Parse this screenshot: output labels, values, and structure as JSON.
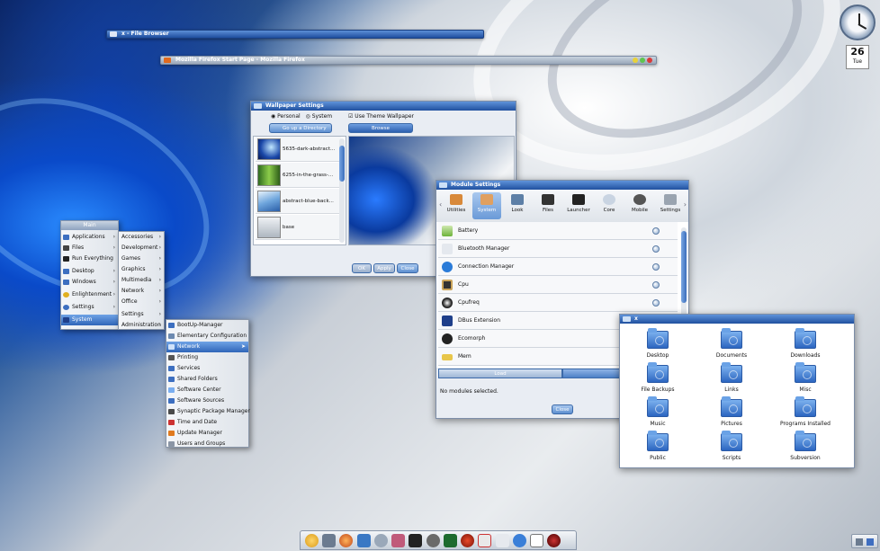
{
  "file_browser": {
    "title": "x - File Browser"
  },
  "firefox": {
    "title": "Mozilla Firefox Start Page - Mozilla Firefox"
  },
  "clock": {
    "day": "26",
    "weekday": "Tue"
  },
  "wallpaper": {
    "title": "Wallpaper Settings",
    "personal": "Personal",
    "system": "System",
    "use_theme": "Use Theme Wallpaper",
    "go_up": "Go up a Directory",
    "browse": "Browse",
    "items": [
      "5635-dark-abstract...",
      "6255-in-the-grass-...",
      "abstract-blue-back...",
      "base"
    ],
    "ok": "OK",
    "apply": "Apply",
    "close": "Close"
  },
  "module": {
    "title": "Module Settings",
    "tabs": [
      "Utilities",
      "System",
      "Look",
      "Files",
      "Launcher",
      "Core",
      "Mobile",
      "Settings"
    ],
    "rows": [
      "Battery",
      "Bluetooth Manager",
      "Connection Manager",
      "Cpu",
      "Cpufreq",
      "DBus Extension",
      "Ecomorph",
      "Mem"
    ],
    "load": "Load",
    "status": "No modules selected.",
    "close": "Close"
  },
  "folders": {
    "title": "x",
    "items": [
      "Desktop",
      "Documents",
      "Downloads",
      "File Backups",
      "Links",
      "Misc",
      "Music",
      "Pictures",
      "Programs Installed",
      "Public",
      "Scripts",
      "Subversion"
    ]
  },
  "main_menu": {
    "header": "Main",
    "items": [
      "Applications",
      "Files",
      "Run Everything",
      "Desktop",
      "Windows",
      "Enlightenment",
      "Settings",
      "System"
    ]
  },
  "apps_menu": {
    "items": [
      "Accessories",
      "Development",
      "Games",
      "Graphics",
      "Multimedia",
      "Network",
      "Office",
      "Settings",
      "Administration"
    ]
  },
  "admin_menu": {
    "items": [
      "BootUp-Manager",
      "Elementary Configuration",
      "Network",
      "Printing",
      "Services",
      "Shared Folders",
      "Software Center",
      "Software Sources",
      "Synaptic Package Manager",
      "Time and Date",
      "Update Manager",
      "Users and Groups"
    ]
  },
  "colors": {
    "accent": "#2f65b8",
    "titlebar": "#20509f"
  }
}
